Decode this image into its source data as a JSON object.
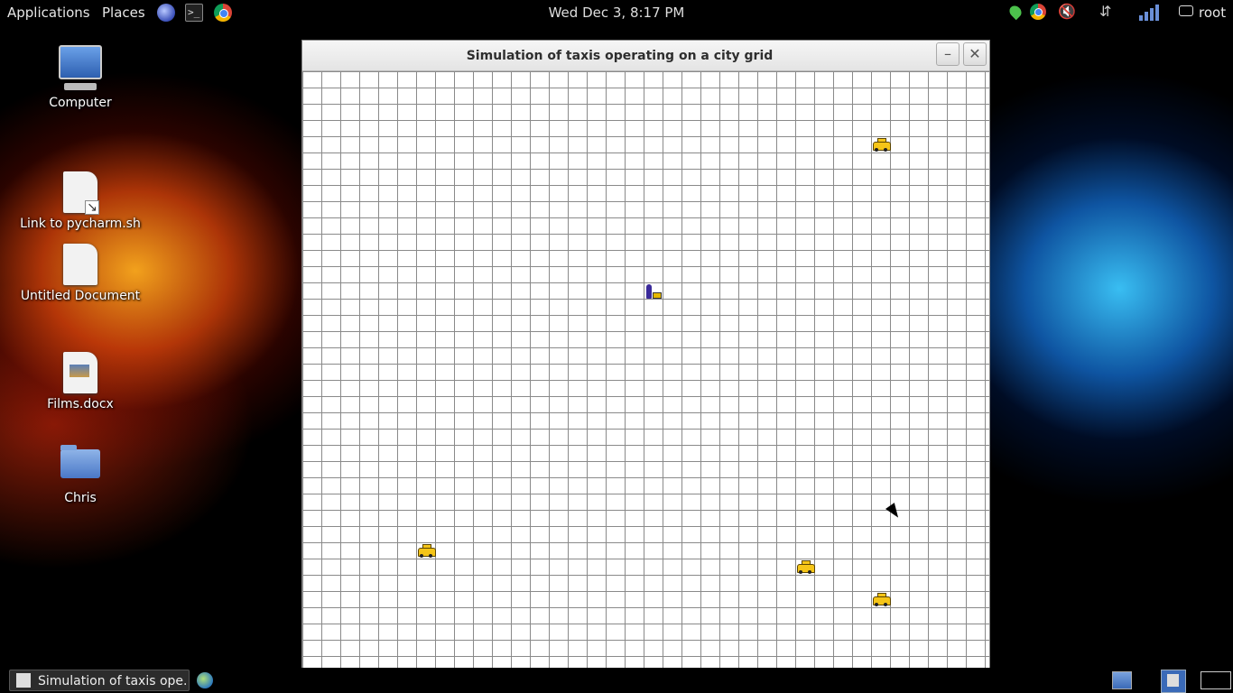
{
  "top_panel": {
    "applications_label": "Applications",
    "places_label": "Places",
    "clock": "Wed Dec  3,  8:17 PM",
    "user": "root",
    "launchers": [
      "globe-icon",
      "terminal-icon",
      "chrome-icon"
    ],
    "tray_icons": [
      "green-status-icon",
      "chrome-icon",
      "volume-muted-icon",
      "network-icon",
      "signal-icon",
      "chat-icon"
    ]
  },
  "desktop": {
    "icons": [
      {
        "label": "Computer",
        "icon": "computer-icon"
      },
      {
        "label": "Link to pycharm.sh",
        "icon": "link-document-icon"
      },
      {
        "label": "Untitled Document",
        "icon": "document-icon"
      },
      {
        "label": "Films.docx",
        "icon": "image-document-icon"
      },
      {
        "label": "Chris",
        "icon": "folder-icon"
      }
    ]
  },
  "window": {
    "title": "Simulation of taxis operating on a city grid",
    "minimize_label": "–",
    "close_label": "✕",
    "entities": [
      {
        "type": "taxi",
        "col": 30,
        "row": 4
      },
      {
        "type": "passenger",
        "col": 18,
        "row": 13
      },
      {
        "type": "taxi",
        "col": 6,
        "row": 29
      },
      {
        "type": "taxi",
        "col": 26,
        "row": 30
      },
      {
        "type": "taxi",
        "col": 30,
        "row": 32
      }
    ]
  },
  "bottom_panel": {
    "task_label": "Simulation of taxis ope...",
    "workspaces": [
      "file-manager-icon",
      "active-workspace-icon",
      "workspace-icon"
    ]
  }
}
